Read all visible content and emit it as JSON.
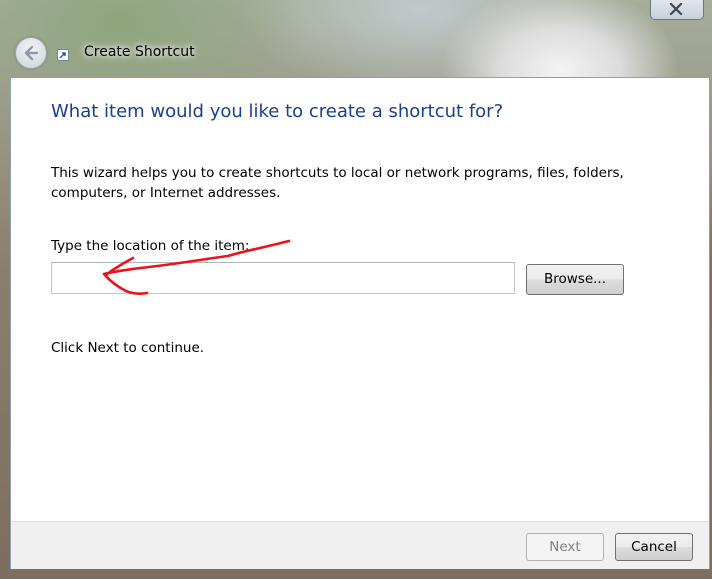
{
  "window": {
    "title": "Create Shortcut",
    "close_icon": "close-icon",
    "back_icon": "back-arrow-icon",
    "title_icon": "shortcut-icon"
  },
  "wizard": {
    "heading": "What item would you like to create a shortcut for?",
    "intro": "This wizard helps you to create shortcuts to local or network programs, files, folders, computers, or Internet addresses.",
    "location_label": "Type the location of the item:",
    "location_value": "",
    "browse_label": "Browse...",
    "continue_text": "Click Next to continue."
  },
  "footer": {
    "next_label": "Next",
    "next_enabled": false,
    "cancel_label": "Cancel"
  },
  "colors": {
    "heading": "#1b3f8f",
    "annotation_stroke": "#e8141a",
    "disabled_text": "#838383"
  }
}
